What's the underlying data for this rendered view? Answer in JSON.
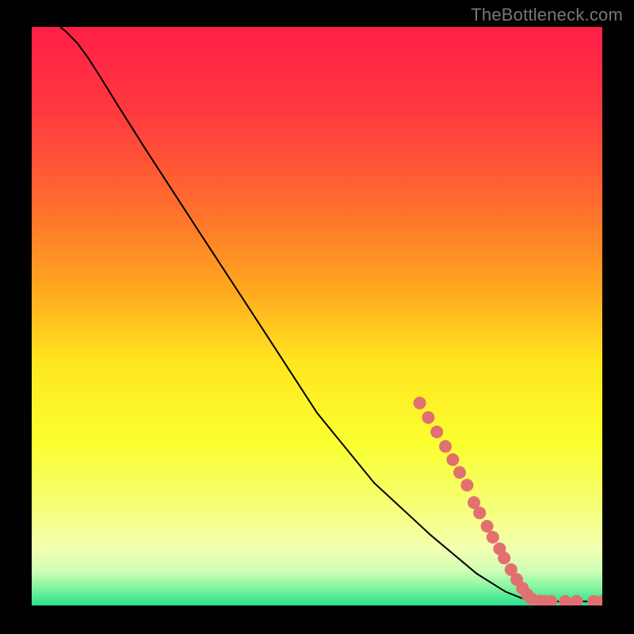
{
  "watermark": "TheBottleneck.com",
  "chart_data": {
    "type": "line",
    "title": "",
    "xlabel": "",
    "ylabel": "",
    "xlim": [
      0,
      100
    ],
    "ylim": [
      0,
      100
    ],
    "grid": false,
    "legend": false,
    "background_gradient": {
      "stops": [
        {
          "pos": 0.0,
          "color": "#ff1f48"
        },
        {
          "pos": 0.15,
          "color": "#ff3a3f"
        },
        {
          "pos": 0.3,
          "color": "#ff6a2f"
        },
        {
          "pos": 0.45,
          "color": "#ffa61f"
        },
        {
          "pos": 0.58,
          "color": "#ffe61f"
        },
        {
          "pos": 0.72,
          "color": "#faff30"
        },
        {
          "pos": 0.82,
          "color": "#f5ff70"
        },
        {
          "pos": 0.9,
          "color": "#f3ffb0"
        },
        {
          "pos": 0.94,
          "color": "#cfffb5"
        },
        {
          "pos": 0.97,
          "color": "#80f5a0"
        },
        {
          "pos": 1.0,
          "color": "#28e08e"
        }
      ]
    },
    "series": [
      {
        "name": "curve",
        "kind": "line",
        "stroke": "#000000",
        "points": [
          {
            "x": 5.0,
            "y": 100.0
          },
          {
            "x": 6.0,
            "y": 99.2
          },
          {
            "x": 8.0,
            "y": 97.2
          },
          {
            "x": 10.0,
            "y": 94.5
          },
          {
            "x": 12.0,
            "y": 91.4
          },
          {
            "x": 15.0,
            "y": 86.6
          },
          {
            "x": 20.0,
            "y": 78.8
          },
          {
            "x": 30.0,
            "y": 63.6
          },
          {
            "x": 40.0,
            "y": 48.5
          },
          {
            "x": 50.0,
            "y": 33.3
          },
          {
            "x": 60.0,
            "y": 21.2
          },
          {
            "x": 70.0,
            "y": 12.1
          },
          {
            "x": 78.0,
            "y": 5.5
          },
          {
            "x": 83.0,
            "y": 2.4
          },
          {
            "x": 86.0,
            "y": 1.2
          },
          {
            "x": 88.0,
            "y": 0.8
          },
          {
            "x": 92.0,
            "y": 0.7
          },
          {
            "x": 96.0,
            "y": 0.7
          },
          {
            "x": 100.0,
            "y": 0.7
          }
        ]
      },
      {
        "name": "markers",
        "kind": "scatter",
        "color": "#e37070",
        "radius": 8,
        "points": [
          {
            "x": 68.0,
            "y": 35.0
          },
          {
            "x": 69.5,
            "y": 32.5
          },
          {
            "x": 71.0,
            "y": 30.0
          },
          {
            "x": 72.5,
            "y": 27.5
          },
          {
            "x": 73.8,
            "y": 25.2
          },
          {
            "x": 75.0,
            "y": 23.0
          },
          {
            "x": 76.3,
            "y": 20.8
          },
          {
            "x": 77.5,
            "y": 17.8
          },
          {
            "x": 78.5,
            "y": 16.0
          },
          {
            "x": 79.8,
            "y": 13.7
          },
          {
            "x": 80.8,
            "y": 11.8
          },
          {
            "x": 82.0,
            "y": 9.8
          },
          {
            "x": 82.8,
            "y": 8.2
          },
          {
            "x": 84.0,
            "y": 6.2
          },
          {
            "x": 85.0,
            "y": 4.5
          },
          {
            "x": 86.0,
            "y": 3.0
          },
          {
            "x": 86.8,
            "y": 1.9
          },
          {
            "x": 87.5,
            "y": 1.2
          },
          {
            "x": 89.0,
            "y": 0.8
          },
          {
            "x": 90.0,
            "y": 0.7
          },
          {
            "x": 91.0,
            "y": 0.7
          },
          {
            "x": 93.5,
            "y": 0.7
          },
          {
            "x": 95.5,
            "y": 0.7
          },
          {
            "x": 98.5,
            "y": 0.7
          },
          {
            "x": 100.0,
            "y": 0.7
          }
        ]
      }
    ]
  }
}
